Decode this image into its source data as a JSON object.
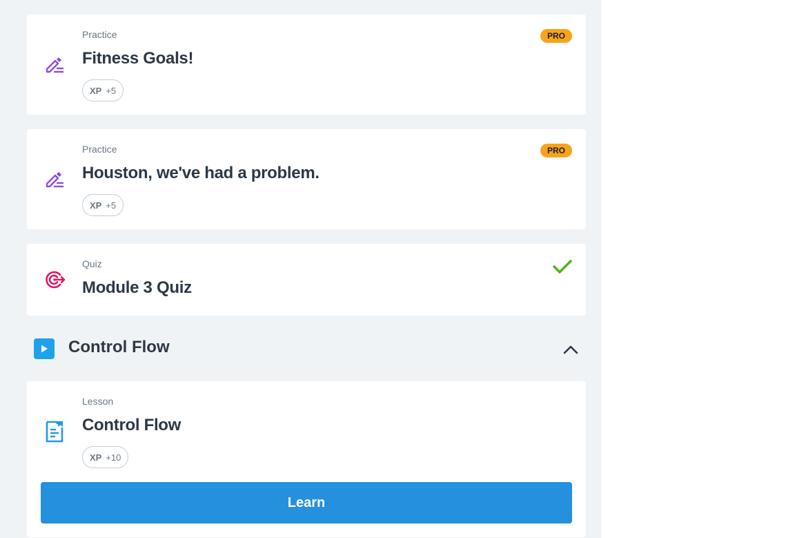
{
  "items": [
    {
      "type": "Practice",
      "title": "Fitness Goals!",
      "xp_label": "XP",
      "xp_value": "+5",
      "badge": "PRO",
      "icon": "pencil-practice-icon"
    },
    {
      "type": "Practice",
      "title": "Houston, we've had a problem.",
      "xp_label": "XP",
      "xp_value": "+5",
      "badge": "PRO",
      "icon": "pencil-practice-icon"
    },
    {
      "type": "Quiz",
      "title": "Module 3 Quiz",
      "status": "completed",
      "icon": "target-quiz-icon"
    }
  ],
  "section": {
    "title": "Control Flow",
    "expanded": true,
    "icon": "play-icon"
  },
  "lesson": {
    "type": "Lesson",
    "title": "Control Flow",
    "xp_label": "XP",
    "xp_value": "+10",
    "button_label": "Learn",
    "icon": "document-lesson-icon"
  },
  "colors": {
    "practice_icon": "#8a4be0",
    "quiz_icon": "#e0165e",
    "lesson_icon": "#1e9be0",
    "pro_badge": "#f9a31a",
    "check": "#4bb317",
    "learn_button": "#2490de",
    "background": "#f0f3f6"
  }
}
